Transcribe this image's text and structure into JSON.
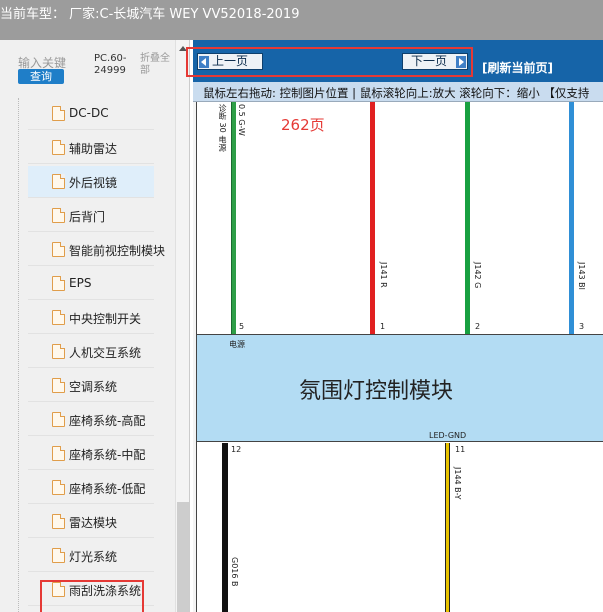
{
  "window": {
    "title": "当前车型： 厂家:C-长城汽车 WEY VV52018-2019"
  },
  "sidebar": {
    "search_label": "输入关键",
    "query_button": "查询",
    "pc_code": "PC.60-24999",
    "fold_label": "折叠全部",
    "items": [
      {
        "label": "DC-DC"
      },
      {
        "label": "辅助雷达"
      },
      {
        "label": "外后视镜"
      },
      {
        "label": "后背门"
      },
      {
        "label": "智能前视控制模块"
      },
      {
        "label": "EPS"
      },
      {
        "label": "中央控制开关"
      },
      {
        "label": "人机交互系统"
      },
      {
        "label": "空调系统"
      },
      {
        "label": "座椅系统-高配"
      },
      {
        "label": "座椅系统-中配"
      },
      {
        "label": "座椅系统-低配"
      },
      {
        "label": "雷达模块"
      },
      {
        "label": "灯光系统"
      },
      {
        "label": "雨刮洗涤系统"
      }
    ]
  },
  "toolbar": {
    "prev_label": "上一页",
    "next_label": "下一页",
    "refresh_label": "[刷新当前页]",
    "hint": "鼠标左右拖动: 控制图片位置 | 鼠标滚轮向上:放大  滚轮向下：缩小 【仅支持"
  },
  "diagram": {
    "page_number": "262页",
    "module_title": "氛围灯控制模块",
    "power_label": "电源",
    "gnd_label": "LED-GND",
    "wires_top": [
      {
        "label": "0.5 G-W",
        "pin": "5",
        "color": "#2e9e47"
      },
      {
        "label": "J141 R",
        "pin": "1",
        "color": "#e12020"
      },
      {
        "label": "J142 G",
        "pin": "2",
        "color": "#18a040"
      },
      {
        "label": "J143 Bl",
        "pin": "3",
        "color": "#2f8fd6"
      }
    ],
    "wires_bottom": [
      {
        "label": "G016 B",
        "pin": "12",
        "color": "#111111"
      },
      {
        "label": "J144 B-Y",
        "pin": "11",
        "color": "#e8c300"
      }
    ],
    "side_note": "诊断 30 电源"
  }
}
